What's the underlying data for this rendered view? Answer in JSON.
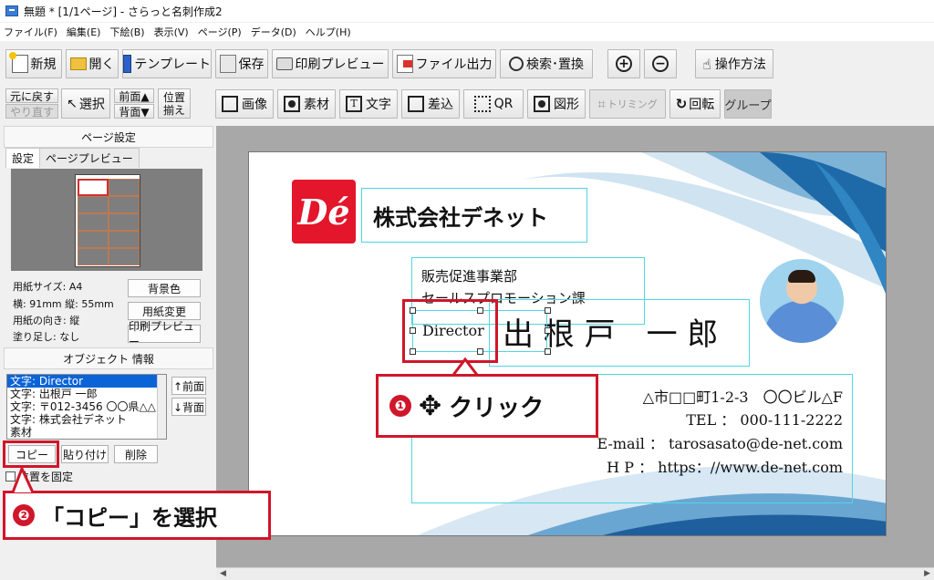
{
  "window": {
    "title": "無題 * [1/1ページ] - さらっと名刺作成2"
  },
  "menu": [
    "ファイル(F)",
    "編集(E)",
    "下絵(B)",
    "表示(V)",
    "ページ(P)",
    "データ(D)",
    "ヘルプ(H)"
  ],
  "toolbar1": {
    "new": "新規",
    "open": "開く",
    "template": "テンプレート",
    "save": "保存",
    "print_preview": "印刷プレビュー",
    "file_export": "ファイル出力",
    "search_replace": "検索･置換",
    "zoom_in": "+",
    "zoom_out": "−",
    "how_to": "操作方法"
  },
  "toolbar2": {
    "undo": "元に戻す",
    "redo": "やり直す",
    "select": "選択",
    "front": "前面▲",
    "back": "背面▼",
    "align_top": "位置",
    "align_bottom": "揃え",
    "image": "画像",
    "material": "素材",
    "text": "文字",
    "merge": "差込",
    "qr": "QR",
    "shape": "図形",
    "trimming": "トリミング",
    "rotate": "回転",
    "group": "グループ"
  },
  "left": {
    "page_settings": "ページ設定",
    "tab_settings": "設定",
    "tab_preview": "ページプレビュー",
    "paper_size": "用紙サイズ: A4",
    "dims": "横: 91mm  縦: 55mm",
    "orientation": "用紙の向き: 縦",
    "bleed": "塗り足し: なし",
    "bg_color": "背景色",
    "change_paper": "用紙変更",
    "print_preview": "印刷プレビュー",
    "object_info": "オブジェクト 情報",
    "objects": [
      "文字: Director",
      "文字: 出根戸 一郎",
      "文字: 〒012-3456 〇〇県△△",
      "文字: 株式会社デネット",
      "素材"
    ],
    "front": "↑前面",
    "back": "↓背面",
    "copy": "コピー",
    "paste": "貼り付け",
    "delete": "削除",
    "lock": "位置を固定"
  },
  "card": {
    "logo": "Dé",
    "company": "株式会社デネット",
    "dept1": "販売促進事業部",
    "dept2": "セールスプロモーション課",
    "title": "Director",
    "name": "出 根 戸　一 郎",
    "address": "△市□□町1-2-3　〇〇ビル△F",
    "tel": "TEL ： 000-111-2222",
    "email": "E-mail ： tarosasato@de-net.com",
    "hp": "H P ： https：//www.de-net.com"
  },
  "callouts": {
    "step1_num": "❶",
    "step1_text": "クリック",
    "step2_num": "❷",
    "step2_text": "「コピー」を選択"
  },
  "colors": {
    "accent_red": "#d0162a",
    "select_blue": "#0a64d8",
    "guide_cyan": "#4fd6e3"
  }
}
